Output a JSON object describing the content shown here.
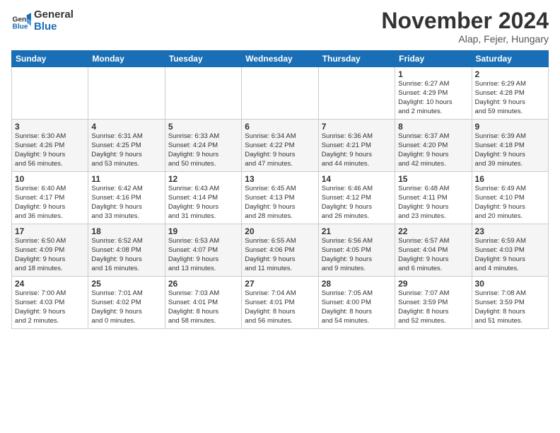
{
  "logo": {
    "line1": "General",
    "line2": "Blue"
  },
  "title": "November 2024",
  "location": "Alap, Fejer, Hungary",
  "weekdays": [
    "Sunday",
    "Monday",
    "Tuesday",
    "Wednesday",
    "Thursday",
    "Friday",
    "Saturday"
  ],
  "weeks": [
    [
      {
        "day": "",
        "info": ""
      },
      {
        "day": "",
        "info": ""
      },
      {
        "day": "",
        "info": ""
      },
      {
        "day": "",
        "info": ""
      },
      {
        "day": "",
        "info": ""
      },
      {
        "day": "1",
        "info": "Sunrise: 6:27 AM\nSunset: 4:29 PM\nDaylight: 10 hours\nand 2 minutes."
      },
      {
        "day": "2",
        "info": "Sunrise: 6:29 AM\nSunset: 4:28 PM\nDaylight: 9 hours\nand 59 minutes."
      }
    ],
    [
      {
        "day": "3",
        "info": "Sunrise: 6:30 AM\nSunset: 4:26 PM\nDaylight: 9 hours\nand 56 minutes."
      },
      {
        "day": "4",
        "info": "Sunrise: 6:31 AM\nSunset: 4:25 PM\nDaylight: 9 hours\nand 53 minutes."
      },
      {
        "day": "5",
        "info": "Sunrise: 6:33 AM\nSunset: 4:24 PM\nDaylight: 9 hours\nand 50 minutes."
      },
      {
        "day": "6",
        "info": "Sunrise: 6:34 AM\nSunset: 4:22 PM\nDaylight: 9 hours\nand 47 minutes."
      },
      {
        "day": "7",
        "info": "Sunrise: 6:36 AM\nSunset: 4:21 PM\nDaylight: 9 hours\nand 44 minutes."
      },
      {
        "day": "8",
        "info": "Sunrise: 6:37 AM\nSunset: 4:20 PM\nDaylight: 9 hours\nand 42 minutes."
      },
      {
        "day": "9",
        "info": "Sunrise: 6:39 AM\nSunset: 4:18 PM\nDaylight: 9 hours\nand 39 minutes."
      }
    ],
    [
      {
        "day": "10",
        "info": "Sunrise: 6:40 AM\nSunset: 4:17 PM\nDaylight: 9 hours\nand 36 minutes."
      },
      {
        "day": "11",
        "info": "Sunrise: 6:42 AM\nSunset: 4:16 PM\nDaylight: 9 hours\nand 33 minutes."
      },
      {
        "day": "12",
        "info": "Sunrise: 6:43 AM\nSunset: 4:14 PM\nDaylight: 9 hours\nand 31 minutes."
      },
      {
        "day": "13",
        "info": "Sunrise: 6:45 AM\nSunset: 4:13 PM\nDaylight: 9 hours\nand 28 minutes."
      },
      {
        "day": "14",
        "info": "Sunrise: 6:46 AM\nSunset: 4:12 PM\nDaylight: 9 hours\nand 26 minutes."
      },
      {
        "day": "15",
        "info": "Sunrise: 6:48 AM\nSunset: 4:11 PM\nDaylight: 9 hours\nand 23 minutes."
      },
      {
        "day": "16",
        "info": "Sunrise: 6:49 AM\nSunset: 4:10 PM\nDaylight: 9 hours\nand 20 minutes."
      }
    ],
    [
      {
        "day": "17",
        "info": "Sunrise: 6:50 AM\nSunset: 4:09 PM\nDaylight: 9 hours\nand 18 minutes."
      },
      {
        "day": "18",
        "info": "Sunrise: 6:52 AM\nSunset: 4:08 PM\nDaylight: 9 hours\nand 16 minutes."
      },
      {
        "day": "19",
        "info": "Sunrise: 6:53 AM\nSunset: 4:07 PM\nDaylight: 9 hours\nand 13 minutes."
      },
      {
        "day": "20",
        "info": "Sunrise: 6:55 AM\nSunset: 4:06 PM\nDaylight: 9 hours\nand 11 minutes."
      },
      {
        "day": "21",
        "info": "Sunrise: 6:56 AM\nSunset: 4:05 PM\nDaylight: 9 hours\nand 9 minutes."
      },
      {
        "day": "22",
        "info": "Sunrise: 6:57 AM\nSunset: 4:04 PM\nDaylight: 9 hours\nand 6 minutes."
      },
      {
        "day": "23",
        "info": "Sunrise: 6:59 AM\nSunset: 4:03 PM\nDaylight: 9 hours\nand 4 minutes."
      }
    ],
    [
      {
        "day": "24",
        "info": "Sunrise: 7:00 AM\nSunset: 4:03 PM\nDaylight: 9 hours\nand 2 minutes."
      },
      {
        "day": "25",
        "info": "Sunrise: 7:01 AM\nSunset: 4:02 PM\nDaylight: 9 hours\nand 0 minutes."
      },
      {
        "day": "26",
        "info": "Sunrise: 7:03 AM\nSunset: 4:01 PM\nDaylight: 8 hours\nand 58 minutes."
      },
      {
        "day": "27",
        "info": "Sunrise: 7:04 AM\nSunset: 4:01 PM\nDaylight: 8 hours\nand 56 minutes."
      },
      {
        "day": "28",
        "info": "Sunrise: 7:05 AM\nSunset: 4:00 PM\nDaylight: 8 hours\nand 54 minutes."
      },
      {
        "day": "29",
        "info": "Sunrise: 7:07 AM\nSunset: 3:59 PM\nDaylight: 8 hours\nand 52 minutes."
      },
      {
        "day": "30",
        "info": "Sunrise: 7:08 AM\nSunset: 3:59 PM\nDaylight: 8 hours\nand 51 minutes."
      }
    ]
  ]
}
